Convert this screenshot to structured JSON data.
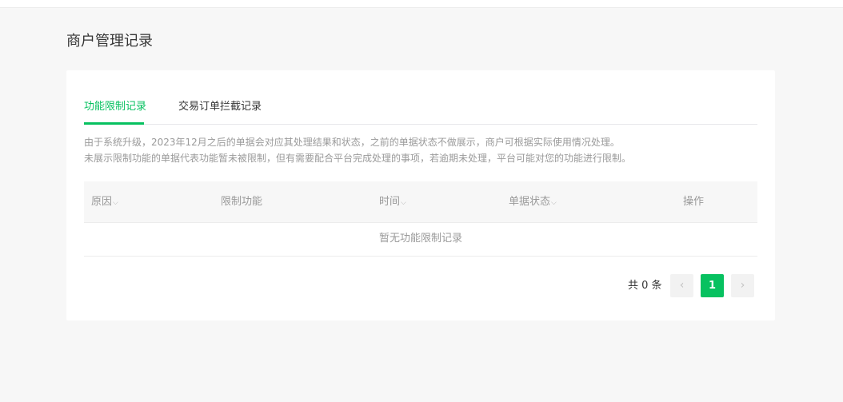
{
  "page": {
    "title": "商户管理记录"
  },
  "tabs": [
    {
      "label": "功能限制记录",
      "active": true
    },
    {
      "label": "交易订单拦截记录",
      "active": false
    }
  ],
  "notice": {
    "line1": "由于系统升级，2023年12月之后的单据会对应其处理结果和状态，之前的单据状态不做展示，商户可根据实际使用情况处理。",
    "line2": "未展示限制功能的单据代表功能暂未被限制，但有需要配合平台完成处理的事项，若逾期未处理，平台可能对您的功能进行限制。"
  },
  "table": {
    "columns": [
      {
        "label": "原因",
        "sortable": true
      },
      {
        "label": "限制功能",
        "sortable": false
      },
      {
        "label": "时间",
        "sortable": true
      },
      {
        "label": "单据状态",
        "sortable": true
      },
      {
        "label": "操作",
        "sortable": false
      }
    ],
    "sort_caret": "⌵",
    "empty_text": "暂无功能限制记录"
  },
  "pagination": {
    "total_text": "共 0 条",
    "prev_icon": "‹",
    "next_icon": "›",
    "current_page": "1"
  },
  "colors": {
    "accent": "#07c160",
    "background": "#f7f7f7",
    "muted_text": "#9a9a9a"
  }
}
